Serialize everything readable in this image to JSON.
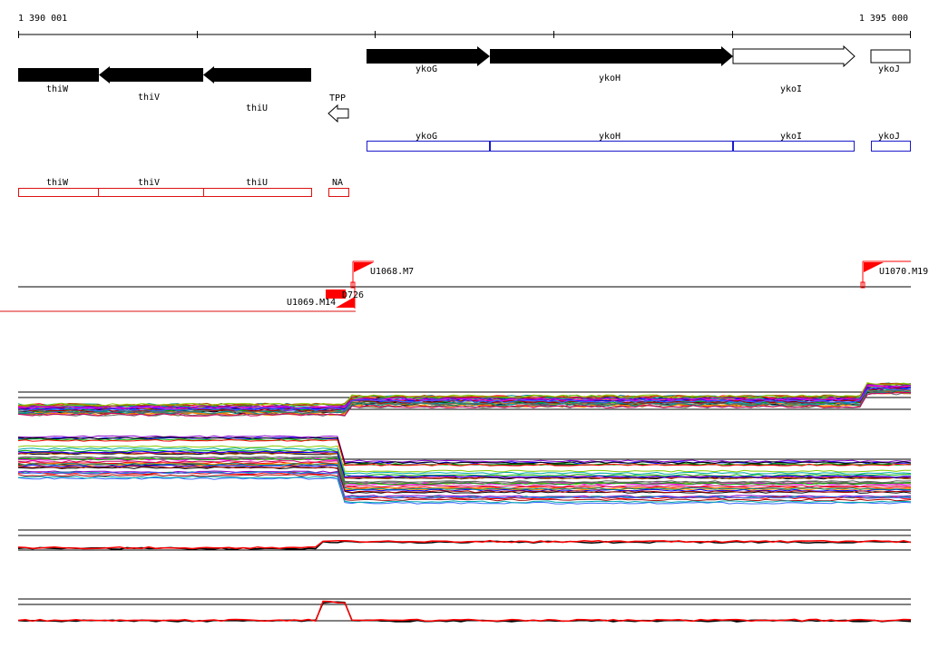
{
  "coordinates": {
    "start_label": "1 390 001",
    "end_label": "1 395 000"
  },
  "genes": [
    {
      "name": "thiW",
      "strand": "-",
      "fill": "black"
    },
    {
      "name": "thiV",
      "strand": "-",
      "fill": "black"
    },
    {
      "name": "thiU",
      "strand": "-",
      "fill": "black"
    },
    {
      "name": "TPP",
      "strand": "-",
      "fill": "white"
    },
    {
      "name": "ykoG",
      "strand": "+",
      "fill": "black"
    },
    {
      "name": "ykoH",
      "strand": "+",
      "fill": "black"
    },
    {
      "name": "ykoI",
      "strand": "+",
      "fill": "white"
    },
    {
      "name": "ykoJ",
      "strand": "+",
      "fill": "white"
    }
  ],
  "blue_track": [
    "ykoG",
    "ykoH",
    "ykoI",
    "ykoJ"
  ],
  "red_track": [
    "thiW",
    "thiV",
    "thiU",
    "NA"
  ],
  "markers": {
    "flags_up": [
      "U1068.M7",
      "U1070.M19"
    ],
    "flags_down": [
      "U1069.M14",
      "D726"
    ]
  },
  "colors": {
    "gene_fill": "#000000",
    "blue_track": "#1a1acc",
    "red_track": "#dd1111",
    "marker_red": "#ff0000"
  }
}
